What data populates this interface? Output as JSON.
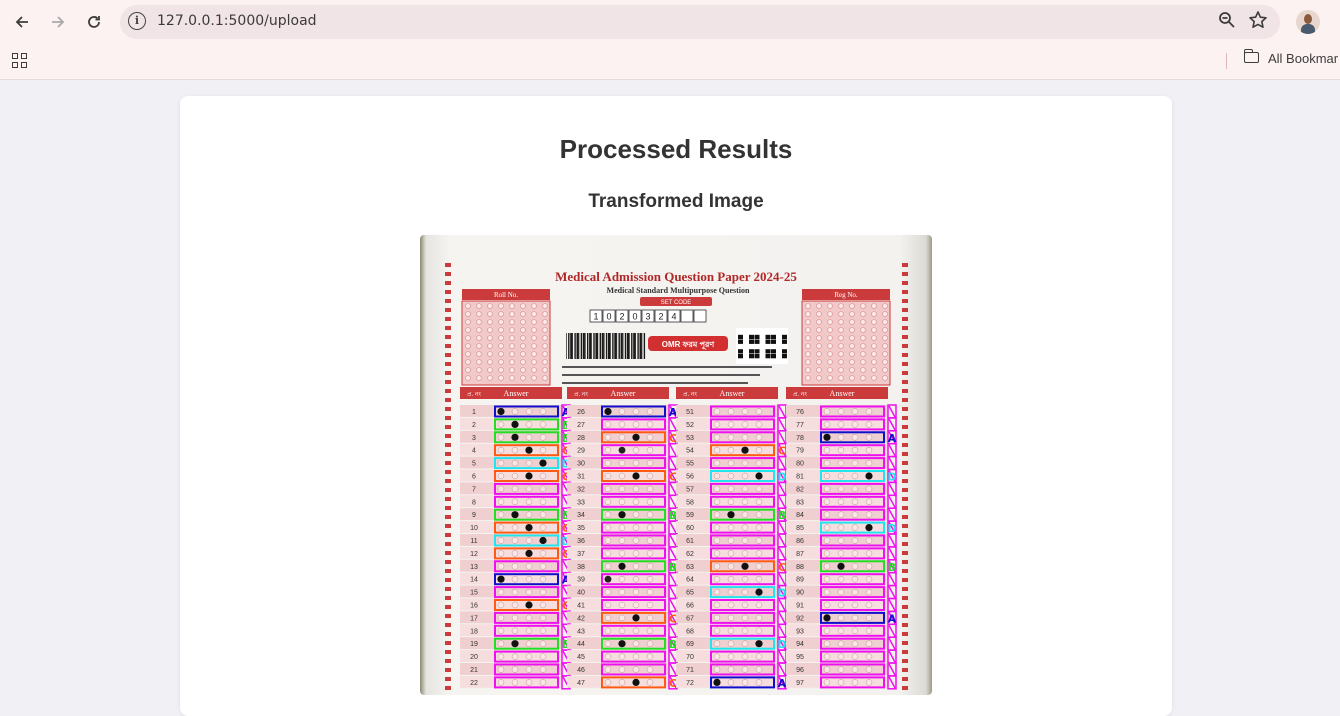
{
  "browser": {
    "url": "127.0.0.1:5000/upload",
    "bookmarks_folder": "All Bookmar",
    "icons": {
      "back": "arrow-left-icon",
      "forward": "arrow-right-icon",
      "reload": "reload-icon",
      "site_info": "info-icon",
      "zoom": "zoom-icon",
      "bookmark": "star-icon",
      "apps": "apps-grid-icon",
      "folder": "folder-icon"
    }
  },
  "page": {
    "title": "Processed Results",
    "subtitle": "Transformed Image"
  },
  "sheet": {
    "title": "Medical Admission Question Paper 2024-25",
    "subtitle": "Medical Standard Multipurpose Question",
    "roll_label": "Roll No.",
    "reg_label": "Reg No.",
    "set_code_label": "SET CODE",
    "set_code_digits": [
      "1",
      "0",
      "2",
      "0",
      "3",
      "2",
      "4",
      "",
      ""
    ],
    "omr_badge": "OMR ফরম পূরণ",
    "answer_header": "Answer",
    "qno_header": "প্র. নং",
    "column_starts": [
      1,
      26,
      51,
      76
    ],
    "annotations": {
      "col1": [
        "A",
        "B",
        "B",
        "C",
        "D",
        "C",
        "",
        "",
        "B",
        "C",
        "D",
        "C",
        "",
        "A",
        "",
        "C",
        "",
        "",
        "B",
        "",
        "",
        ""
      ],
      "col2": [
        "A",
        "",
        "C",
        "",
        "",
        "C",
        "",
        "",
        "B",
        "",
        "",
        "",
        "B",
        "",
        "",
        "",
        "C",
        "",
        "B",
        "",
        "",
        "C"
      ],
      "col3": [
        "",
        "",
        "",
        "C",
        "",
        "D",
        "",
        "",
        "B",
        "",
        "",
        "",
        "C",
        "",
        "D",
        "",
        "",
        "",
        "D",
        "",
        "",
        "A"
      ],
      "col4": [
        "",
        "",
        "A",
        "",
        "",
        "D",
        "",
        "",
        "",
        "D",
        "",
        "",
        "B",
        "",
        "",
        "",
        "A",
        "",
        "",
        "",
        "",
        ""
      ]
    },
    "colors": {
      "A": "#1010cc",
      "B": "#22dd22",
      "C": "#ff5a14",
      "D": "#22e4ee",
      "none": "#ee10ee",
      "print_red": "#cc3b3b"
    }
  }
}
